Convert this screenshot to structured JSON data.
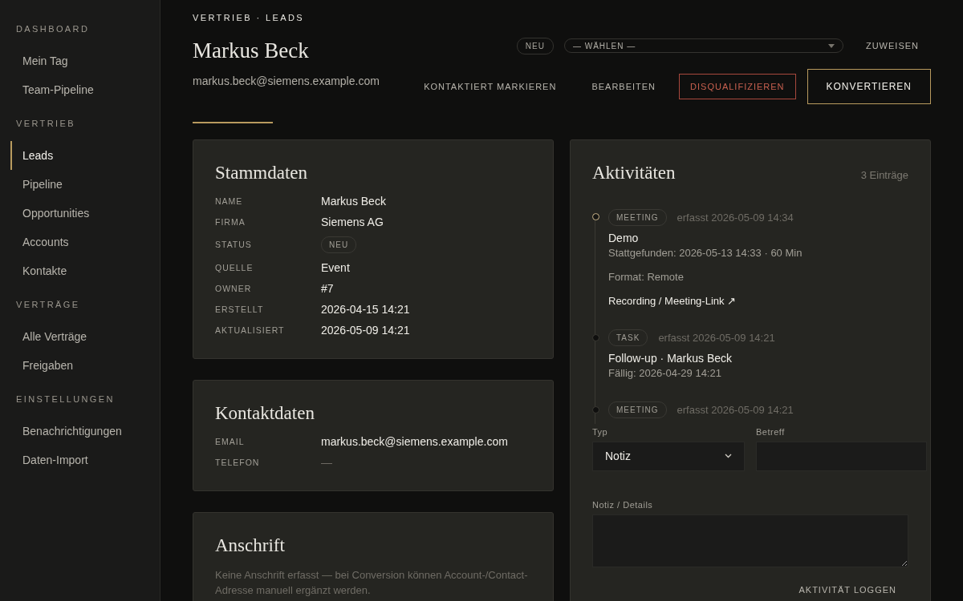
{
  "sidebar": {
    "sections": [
      {
        "title": "DASHBOARD",
        "items": [
          {
            "label": "Mein Tag",
            "selected": false
          },
          {
            "label": "Team-Pipeline",
            "selected": false
          }
        ]
      },
      {
        "title": "VERTRIEB",
        "items": [
          {
            "label": "Leads",
            "selected": true
          },
          {
            "label": "Pipeline",
            "selected": false
          },
          {
            "label": "Opportunities",
            "selected": false
          },
          {
            "label": "Accounts",
            "selected": false
          },
          {
            "label": "Kontakte",
            "selected": false
          }
        ]
      },
      {
        "title": "VERTRÄGE",
        "items": [
          {
            "label": "Alle Verträge",
            "selected": false
          },
          {
            "label": "Freigaben",
            "selected": false
          }
        ]
      },
      {
        "title": "EINSTELLUNGEN",
        "items": [
          {
            "label": "Benachrichtigungen",
            "selected": false
          },
          {
            "label": "Daten-Import",
            "selected": false
          }
        ]
      }
    ]
  },
  "breadcrumb": "VERTRIEB · LEADS",
  "header": {
    "name": "Markus Beck",
    "email": "markus.beck@siemens.example.com"
  },
  "assign": {
    "status_badge": "NEU",
    "select": {
      "value": "— WÄHLEN —"
    },
    "button": "ZUWEISEN"
  },
  "actions": [
    {
      "label": "KONTAKTIERT MARKIEREN",
      "kind": "text"
    },
    {
      "label": "BEARBEITEN",
      "kind": "text"
    },
    {
      "label": "DISQUALIFIZIEREN",
      "kind": "danger"
    },
    {
      "label": "KONVERTIEREN",
      "kind": "primary"
    }
  ],
  "cards": [
    {
      "title": "Stammdaten",
      "fields": [
        {
          "label": "NAME",
          "value": "Markus Beck",
          "kind": "text"
        },
        {
          "label": "FIRMA",
          "value": "Siemens AG",
          "kind": "text"
        },
        {
          "label": "STATUS",
          "value": "NEU",
          "kind": "badge"
        },
        {
          "label": "QUELLE",
          "value": "Event",
          "kind": "text"
        },
        {
          "label": "OWNER",
          "value": "#7",
          "kind": "text"
        },
        {
          "label": "ERSTELLT",
          "value": "2026-04-15 14:21",
          "kind": "text"
        },
        {
          "label": "AKTUALISIERT",
          "value": "2026-05-09 14:21",
          "kind": "text"
        }
      ]
    },
    {
      "title": "Kontaktdaten",
      "fields": [
        {
          "label": "EMAIL",
          "value": "markus.beck@siemens.example.com",
          "kind": "text"
        },
        {
          "label": "TELEFON",
          "value": "—",
          "kind": "muted"
        }
      ]
    },
    {
      "title": "Anschrift",
      "note": "Keine Anschrift erfasst — bei Conversion können Account-/Contact-Adresse manuell ergänzt werden."
    }
  ],
  "activities": {
    "title": "Aktivitäten",
    "count": "3 Einträge",
    "items": [
      {
        "type": "MEETING",
        "recorded": "erfasst 2026-05-09 14:34",
        "active": true,
        "title": "Demo",
        "subtitle": "Stattgefunden: 2026-05-13 14:33 · 60 Min",
        "notes": [
          "Format: Remote"
        ],
        "link": "Recording / Meeting-Link ↗"
      },
      {
        "type": "TASK",
        "recorded": "erfasst 2026-05-09 14:21",
        "active": false,
        "title": "Follow-up · Markus Beck",
        "subtitle": "Fällig: 2026-04-29 14:21"
      },
      {
        "type": "MEETING",
        "recorded": "erfasst 2026-05-09 14:21",
        "active": false
      }
    ]
  },
  "form": {
    "type": {
      "label": "Typ",
      "value": "Notiz"
    },
    "subject": {
      "label": "Betreff"
    },
    "details": {
      "label": "Notiz / Details"
    },
    "submit": "AKTIVITÄT LOGGEN"
  }
}
